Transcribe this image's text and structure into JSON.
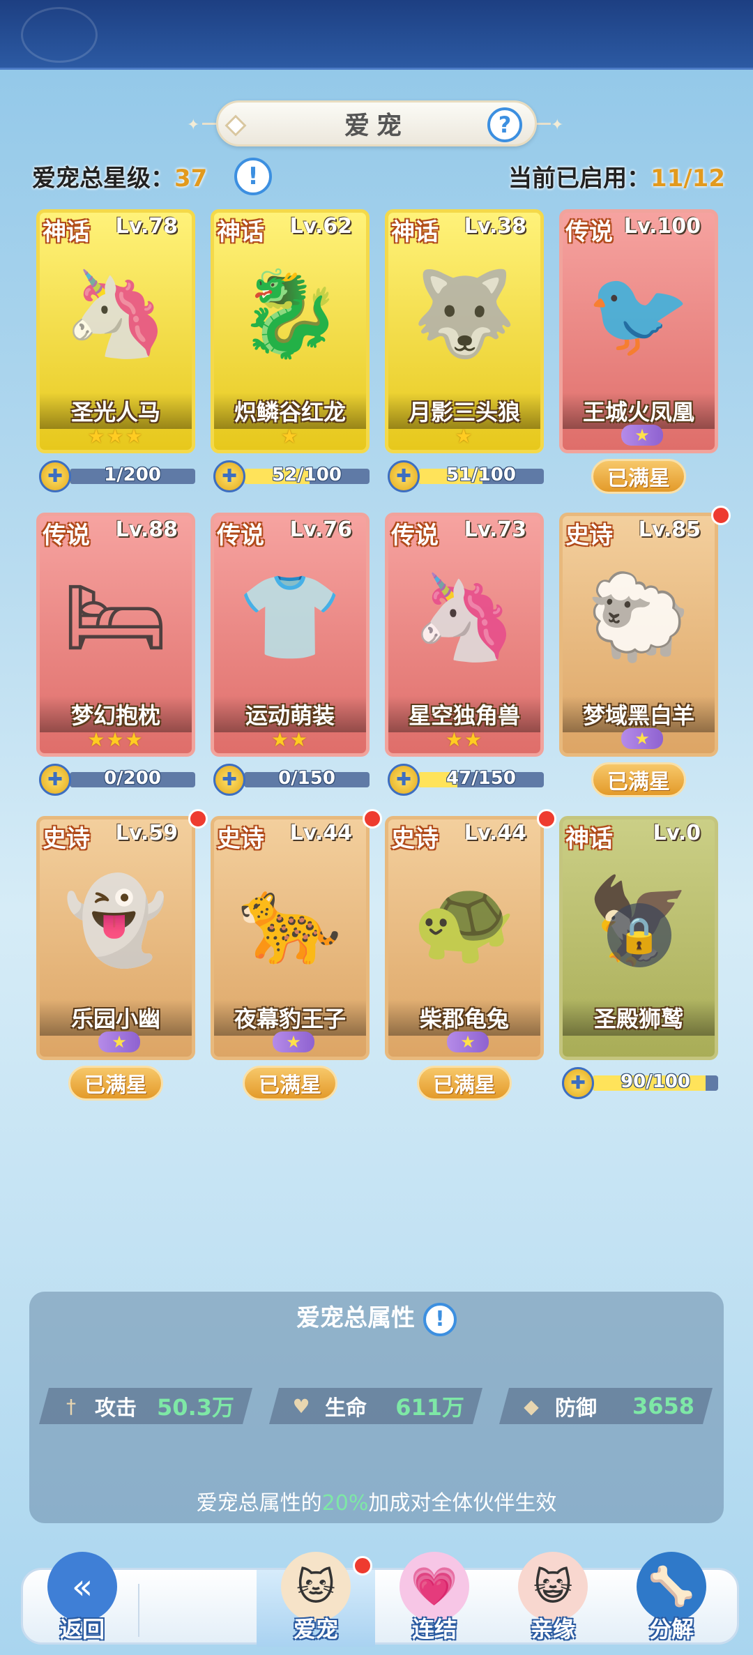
{
  "header": {
    "title": "爱宠"
  },
  "summary": {
    "total_star_label": "爱宠总星级：",
    "total_star_value": "37",
    "enabled_label": "当前已启用：",
    "enabled_value": "11/12"
  },
  "pets": [
    {
      "rarity": "神话",
      "level": "Lv.78",
      "name": "圣光人马",
      "stars": "★★★",
      "progress": "1/200",
      "fill": 0.005,
      "tone": "myth",
      "icon": "🦄"
    },
    {
      "rarity": "神话",
      "level": "Lv.62",
      "name": "炽鳞谷红龙",
      "stars": "★",
      "progress": "52/100",
      "fill": 0.52,
      "tone": "myth",
      "icon": "🐉"
    },
    {
      "rarity": "神话",
      "level": "Lv.38",
      "name": "月影三头狼",
      "stars": "★",
      "progress": "51/100",
      "fill": 0.51,
      "tone": "myth",
      "icon": "🐺"
    },
    {
      "rarity": "传说",
      "level": "Lv.100",
      "name": "王城火凤凰",
      "badge": "★",
      "full": "已满星",
      "tone": "legend",
      "icon": "🐦"
    },
    {
      "rarity": "传说",
      "level": "Lv.88",
      "name": "梦幻抱枕",
      "stars": "★★★",
      "progress": "0/200",
      "fill": 0,
      "tone": "legend",
      "icon": "🛏"
    },
    {
      "rarity": "传说",
      "level": "Lv.76",
      "name": "运动萌装",
      "stars": "★★",
      "progress": "0/150",
      "fill": 0,
      "tone": "legend",
      "icon": "👕"
    },
    {
      "rarity": "传说",
      "level": "Lv.73",
      "name": "星空独角兽",
      "stars": "★★",
      "progress": "47/150",
      "fill": 0.313,
      "tone": "legend",
      "icon": "🦄"
    },
    {
      "rarity": "史诗",
      "level": "Lv.85",
      "name": "梦域黑白羊",
      "badge": "★",
      "full": "已满星",
      "tone": "epic",
      "icon": "🐑",
      "dot": true
    },
    {
      "rarity": "史诗",
      "level": "Lv.59",
      "name": "乐园小幽",
      "badge": "★",
      "full": "已满星",
      "tone": "epic",
      "icon": "👻",
      "dot": true
    },
    {
      "rarity": "史诗",
      "level": "Lv.44",
      "name": "夜幕豹王子",
      "badge": "★",
      "full": "已满星",
      "tone": "epic",
      "icon": "🐆",
      "dot": true
    },
    {
      "rarity": "史诗",
      "level": "Lv.44",
      "name": "柴郡龟兔",
      "badge": "★",
      "full": "已满星",
      "tone": "epic",
      "icon": "🐢",
      "dot": true
    },
    {
      "rarity": "神话",
      "level": "Lv.0",
      "name": "圣殿狮鹫",
      "progress": "90/100",
      "fill": 0.9,
      "tone": "locked",
      "icon": "🦅",
      "locked": true
    }
  ],
  "attributes": {
    "title": "爱宠总属性",
    "items": [
      {
        "label": "攻击",
        "value": "50.3万",
        "icon": "sword-icon"
      },
      {
        "label": "生命",
        "value": "611万",
        "icon": "heart-icon"
      },
      {
        "label": "防御",
        "value": "3658",
        "icon": "shield-icon"
      }
    ],
    "note_pre": "爱宠总属性的",
    "note_pct": "20%",
    "note_post": "加成对全体伙伴生效"
  },
  "nav": {
    "back": "返回",
    "pet": "爱宠",
    "link": "连结",
    "bond": "亲缘",
    "decompose": "分解"
  },
  "colors": {
    "myth": "#e7c81c",
    "legend": "#df6e6a",
    "epic": "#dda565",
    "accent": "#3c8fe0"
  }
}
